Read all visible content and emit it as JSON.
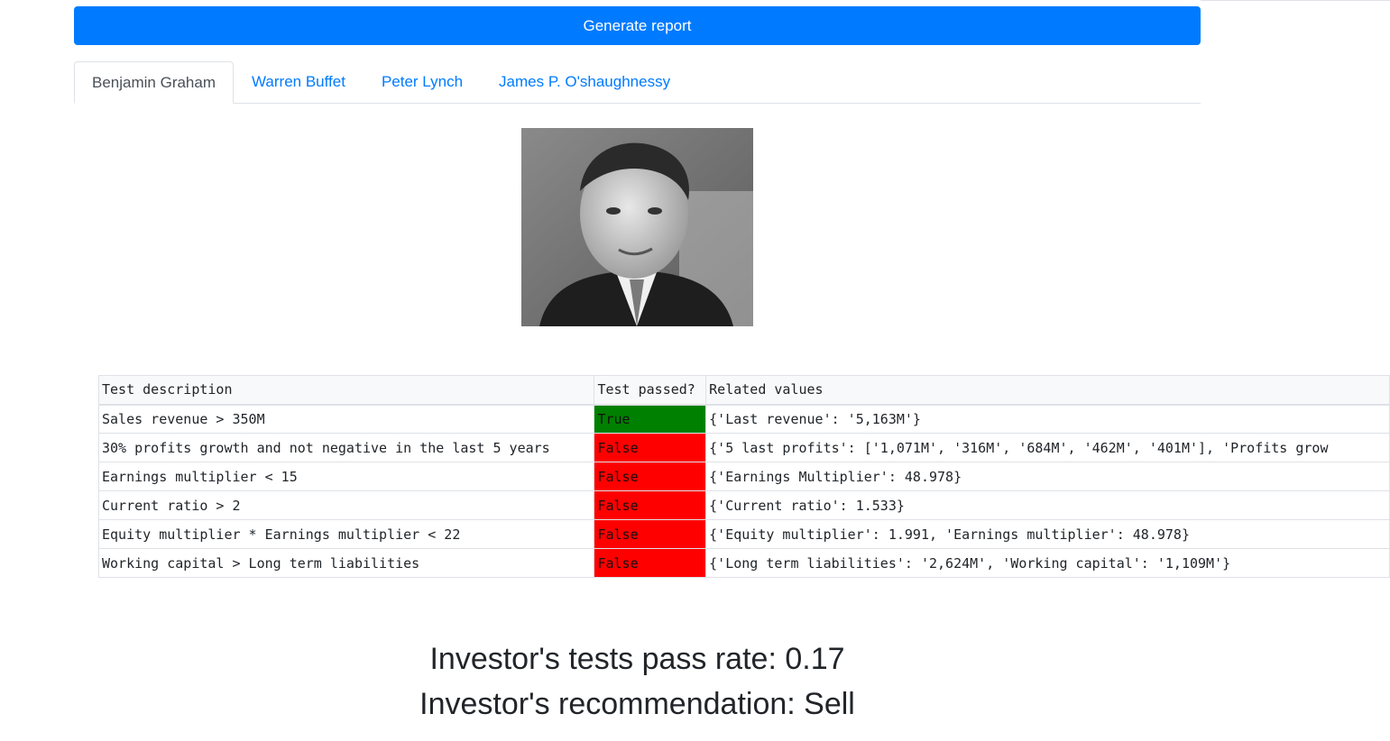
{
  "generate_button": "Generate report",
  "tabs": [
    "Benjamin Graham",
    "Warren Buffet",
    "Peter Lynch",
    "James P. O'shaughnessy"
  ],
  "table": {
    "headers": [
      "Test description",
      "Test passed?",
      "Related values"
    ],
    "rows": [
      {
        "desc": "Sales revenue > 350M",
        "passed": "True",
        "values": "{'Last revenue': '5,163M'}"
      },
      {
        "desc": "30% profits growth and not negative in the last 5 years",
        "passed": "False",
        "values": "{'5 last profits': ['1,071M', '316M', '684M', '462M', '401M'], 'Profits grow"
      },
      {
        "desc": "Earnings multiplier < 15",
        "passed": "False",
        "values": "{'Earnings Multiplier': 48.978}"
      },
      {
        "desc": "Current ratio > 2",
        "passed": "False",
        "values": "{'Current ratio': 1.533}"
      },
      {
        "desc": "Equity multiplier * Earnings multiplier < 22",
        "passed": "False",
        "values": "{'Equity multiplier': 1.991, 'Earnings multiplier': 48.978}"
      },
      {
        "desc": "Working capital > Long term liabilities",
        "passed": "False",
        "values": "{'Long term liabilities': '2,624M', 'Working capital': '1,109M'}"
      }
    ]
  },
  "summary": {
    "pass_rate": "Investor's tests pass rate: 0.17",
    "recommendation": "Investor's recommendation: Sell"
  },
  "colors": {
    "primary": "#007bff",
    "pass": "#008000",
    "fail": "#ff0000"
  }
}
